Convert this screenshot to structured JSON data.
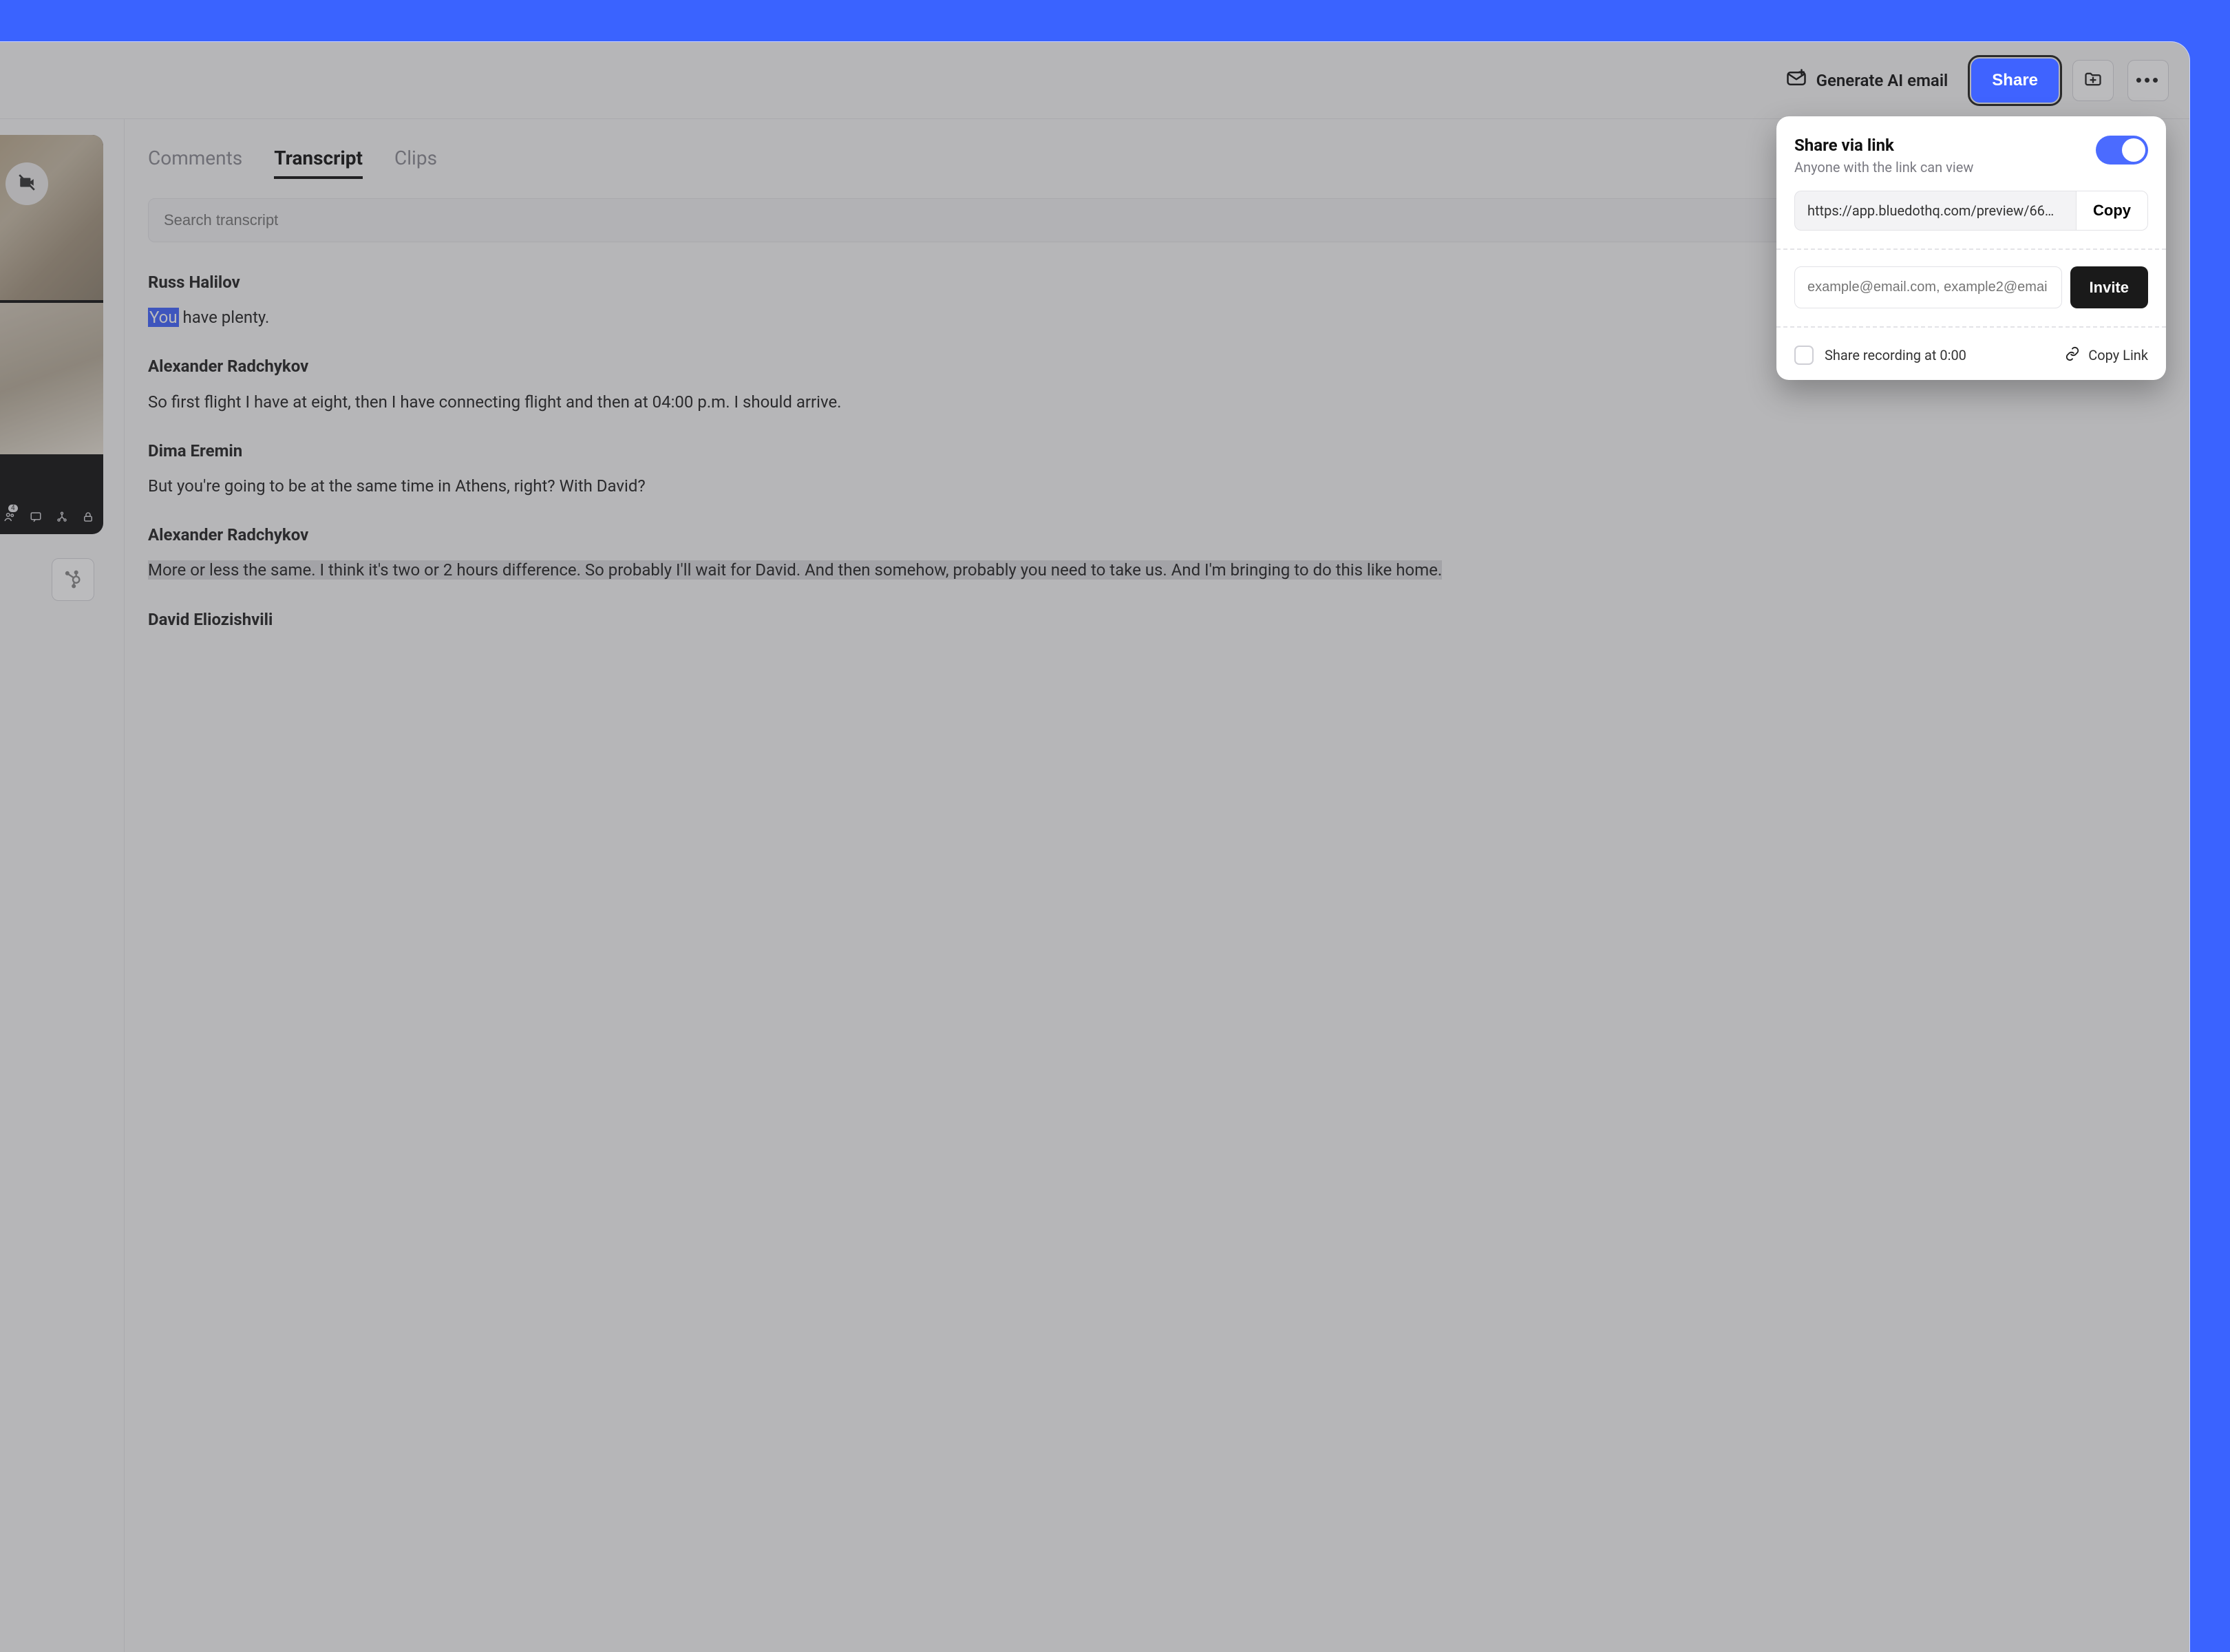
{
  "toolbar": {
    "ai_email_label": "Generate AI email",
    "share_label": "Share"
  },
  "tabs": {
    "items": [
      "Comments",
      "Transcript",
      "Clips"
    ],
    "active_index": 1
  },
  "search": {
    "placeholder": "Search transcript"
  },
  "transcript": [
    {
      "speaker": "Russ Halilov",
      "text_pre_hl": "",
      "hl": "You",
      "text_post_hl": " have plenty.",
      "selected": false
    },
    {
      "speaker": "Alexander Radchykov",
      "text": "So first flight I have at eight, then I have connecting flight and then at 04:00 p.m. I should arrive.",
      "selected": false
    },
    {
      "speaker": "Dima Eremin",
      "text": "But you're going to be at the same time in Athens, right? With David?",
      "selected": false
    },
    {
      "speaker": "Alexander Radchykov",
      "text": "More or less the same. I think it's two or 2 hours difference. So probably I'll wait for David. And then somehow, probably you need to take us. And I'm bringing to do this like home.",
      "selected": true
    },
    {
      "speaker": "David Eliozishvili",
      "text": "",
      "selected": false
    }
  ],
  "video_footer_badge": "4",
  "share_popover": {
    "title": "Share via link",
    "subtitle": "Anyone with the link can view",
    "toggle_on": true,
    "link_value": "https://app.bluedothq.com/preview/66…",
    "copy_label": "Copy",
    "email_placeholder": "example@email.com, example2@emai…",
    "invite_label": "Invite",
    "share_at_label": "Share recording at 0:00",
    "copy_link_label": "Copy Link"
  }
}
